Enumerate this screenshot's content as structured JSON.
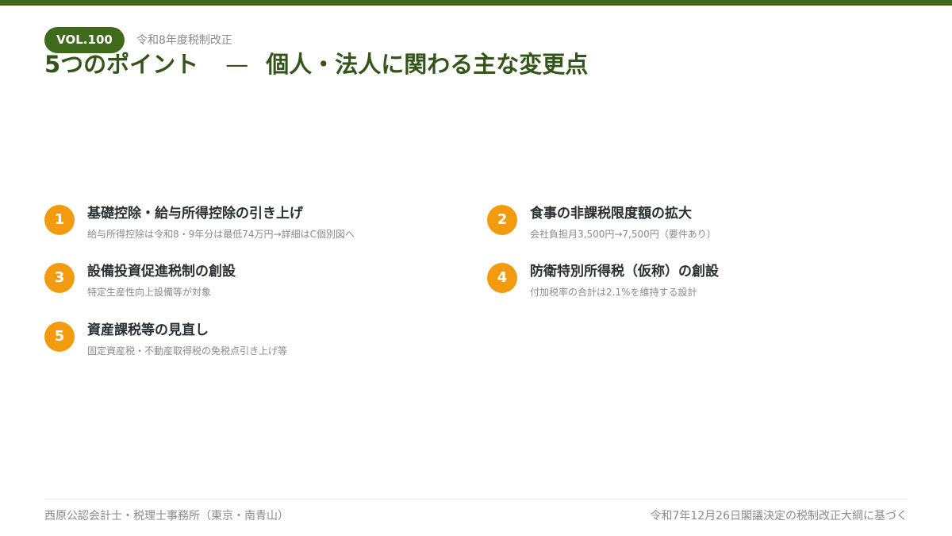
{
  "header": {
    "badge": "VOL.100",
    "subtitle": "令和8年度税制改正",
    "title_main": "5つのポイント",
    "title_dash": "—",
    "title_sub": "個人・法人に関わる主な変更点"
  },
  "points": [
    {
      "num": "1",
      "title": "基礎控除・給与所得控除の引き上げ",
      "desc": "給与所得控除は令和8・9年分は最低74万円→詳細はC個別図へ"
    },
    {
      "num": "2",
      "title": "食事の非課税限度額の拡大",
      "desc": "会社負担月3,500円→7,500円（要件あり）"
    },
    {
      "num": "3",
      "title": "設備投資促進税制の創設",
      "desc": "特定生産性向上設備等が対象"
    },
    {
      "num": "4",
      "title": "防衛特別所得税（仮称）の創設",
      "desc": "付加税率の合計は2.1%を維持する設計"
    },
    {
      "num": "5",
      "title": "資産課税等の見直し",
      "desc": "固定資産税・不動産取得税の免税点引き上げ等"
    }
  ],
  "footer": {
    "left": "西原公認会計士・税理士事務所（東京・南青山）",
    "right": "令和7年12月26日閣議決定の税制改正大綱に基づく"
  },
  "colors": {
    "brand_green": "#3f6a1c",
    "title_green": "#34551a",
    "accent_orange": "#f29b0e",
    "muted_text": "#8a8a8a"
  }
}
